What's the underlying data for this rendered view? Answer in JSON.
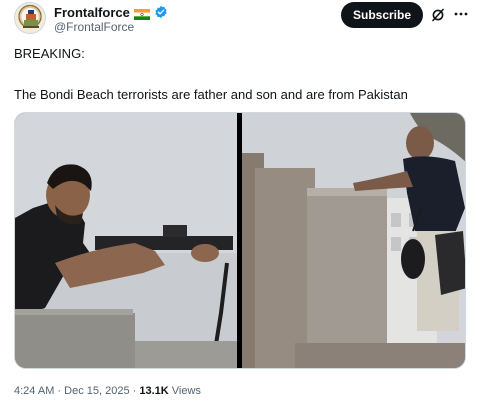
{
  "author": {
    "display_name": "Frontalforce",
    "handle": "@FrontalForce",
    "flag_icon": "india-flag-icon",
    "verified_icon": "verified-badge-icon",
    "verified_color": "#1d9bf0"
  },
  "actions": {
    "subscribe_label": "Subscribe",
    "grok_icon": "grok-icon",
    "more_icon": "more-options-icon"
  },
  "post": {
    "line1": "BREAKING:",
    "line2": "The Bondi Beach terrorists are father and son and are from Pakistan"
  },
  "meta": {
    "time": "4:24 AM",
    "separator1": " · ",
    "date": "Dec 15, 2025",
    "separator2": " · ",
    "views_count": "13.1K",
    "views_label": " Views"
  },
  "colors": {
    "text_primary": "#0f1419",
    "text_secondary": "#536471",
    "button_bg": "#0f1419",
    "border": "#cfd9de"
  }
}
